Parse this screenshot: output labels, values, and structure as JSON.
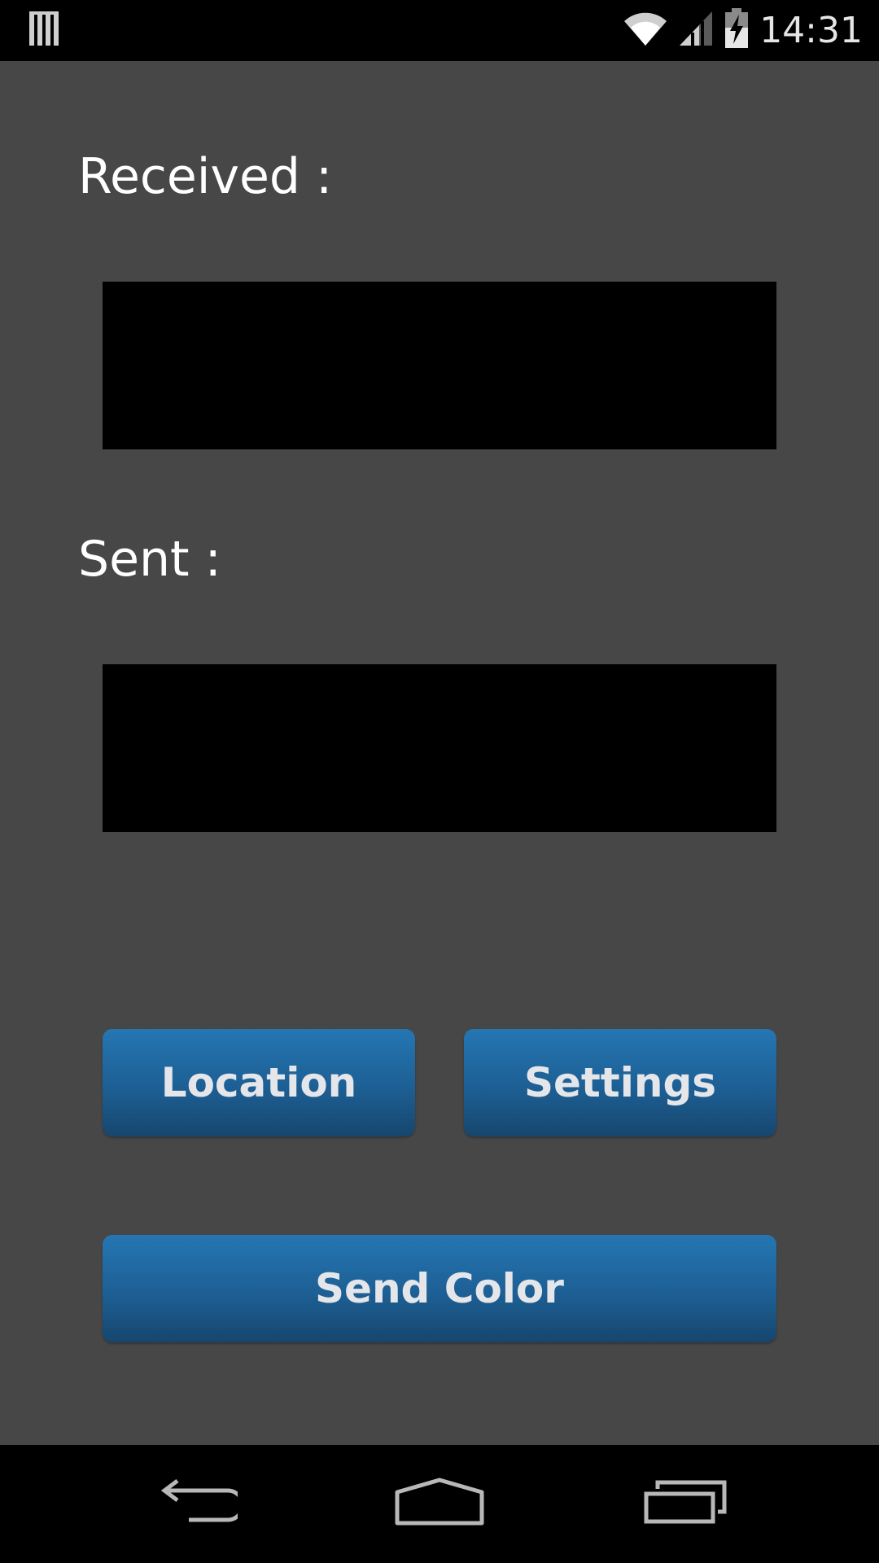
{
  "status_bar": {
    "time": "14:31",
    "icons": [
      "notification-icon",
      "wifi-icon",
      "signal-icon",
      "battery-charging-icon"
    ]
  },
  "main": {
    "received_label": "Received :",
    "sent_label": "Sent :",
    "received_color": "#000000",
    "sent_color": "#000000",
    "background_color": "#474747"
  },
  "buttons": {
    "location_label": "Location",
    "settings_label": "Settings",
    "send_color_label": "Send Color",
    "accent_color": "#1f6aa5"
  },
  "nav_bar": {
    "icons": [
      "back-icon",
      "home-icon",
      "recent-apps-icon"
    ]
  }
}
